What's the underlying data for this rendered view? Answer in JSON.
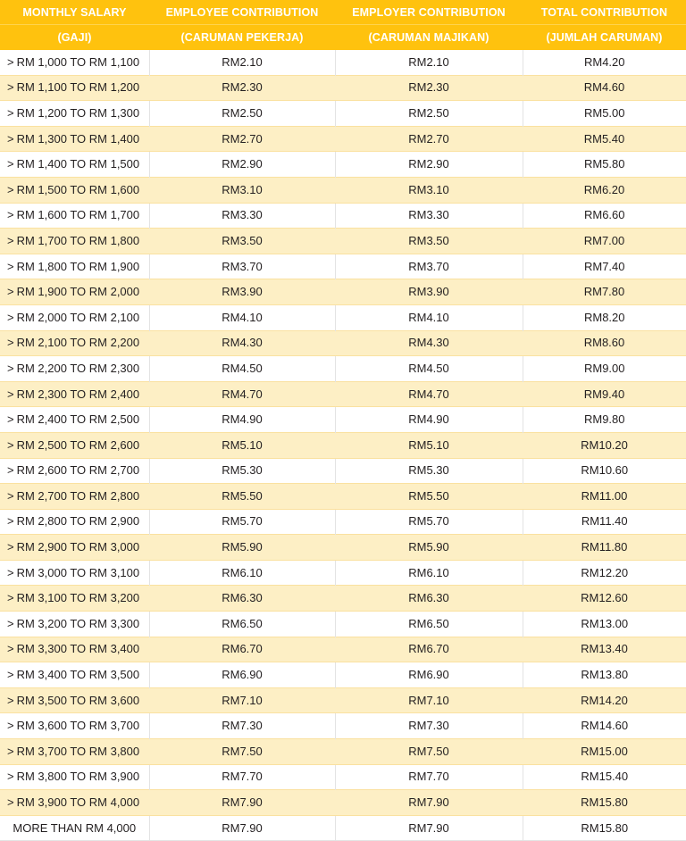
{
  "table": {
    "header": {
      "line1": [
        "MONTHLY SALARY",
        "EMPLOYEE CONTRIBUTION",
        "EMPLOYER CONTRIBUTION",
        "TOTAL CONTRIBUTION"
      ],
      "line2": [
        "(GAJI)",
        "(CARUMAN PEKERJA)",
        "(CARUMAN MAJIKAN)",
        "(JUMLAH CARUMAN)"
      ]
    },
    "colors": {
      "header_background": "#FFC20E",
      "header_text": "#FFFFFF",
      "row_odd_background": "#FFFFFF",
      "row_even_background": "#FDEFC5",
      "row_even_border": "#FAE1A0",
      "column_divider": "#E3E3E3",
      "body_text": "#231F20"
    },
    "rows": [
      {
        "marker": ">",
        "salary": "RM 1,000 TO RM 1,100",
        "employee": "RM2.10",
        "employer": "RM2.10",
        "total": "RM4.20"
      },
      {
        "marker": ">",
        "salary": "RM 1,100 TO RM 1,200",
        "employee": "RM2.30",
        "employer": "RM2.30",
        "total": "RM4.60"
      },
      {
        "marker": ">",
        "salary": "RM 1,200 TO RM 1,300",
        "employee": "RM2.50",
        "employer": "RM2.50",
        "total": "RM5.00"
      },
      {
        "marker": ">",
        "salary": "RM 1,300 TO RM 1,400",
        "employee": "RM2.70",
        "employer": "RM2.70",
        "total": "RM5.40"
      },
      {
        "marker": ">",
        "salary": "RM 1,400 TO RM 1,500",
        "employee": "RM2.90",
        "employer": "RM2.90",
        "total": "RM5.80"
      },
      {
        "marker": ">",
        "salary": "RM 1,500 TO RM 1,600",
        "employee": "RM3.10",
        "employer": "RM3.10",
        "total": "RM6.20"
      },
      {
        "marker": ">",
        "salary": "RM 1,600 TO RM 1,700",
        "employee": "RM3.30",
        "employer": "RM3.30",
        "total": "RM6.60"
      },
      {
        "marker": ">",
        "salary": "RM 1,700 TO RM 1,800",
        "employee": "RM3.50",
        "employer": "RM3.50",
        "total": "RM7.00"
      },
      {
        "marker": ">",
        "salary": "RM 1,800 TO RM 1,900",
        "employee": "RM3.70",
        "employer": "RM3.70",
        "total": "RM7.40"
      },
      {
        "marker": ">",
        "salary": "RM 1,900 TO RM 2,000",
        "employee": "RM3.90",
        "employer": "RM3.90",
        "total": "RM7.80"
      },
      {
        "marker": ">",
        "salary": "RM 2,000 TO RM 2,100",
        "employee": "RM4.10",
        "employer": "RM4.10",
        "total": "RM8.20"
      },
      {
        "marker": ">",
        "salary": "RM 2,100 TO RM 2,200",
        "employee": "RM4.30",
        "employer": "RM4.30",
        "total": "RM8.60"
      },
      {
        "marker": ">",
        "salary": "RM 2,200 TO RM 2,300",
        "employee": "RM4.50",
        "employer": "RM4.50",
        "total": "RM9.00"
      },
      {
        "marker": ">",
        "salary": "RM 2,300 TO RM 2,400",
        "employee": "RM4.70",
        "employer": "RM4.70",
        "total": "RM9.40"
      },
      {
        "marker": ">",
        "salary": "RM 2,400 TO RM 2,500",
        "employee": "RM4.90",
        "employer": "RM4.90",
        "total": "RM9.80"
      },
      {
        "marker": ">",
        "salary": "RM 2,500 TO RM 2,600",
        "employee": "RM5.10",
        "employer": "RM5.10",
        "total": "RM10.20"
      },
      {
        "marker": ">",
        "salary": "RM 2,600 TO RM 2,700",
        "employee": "RM5.30",
        "employer": "RM5.30",
        "total": "RM10.60"
      },
      {
        "marker": ">",
        "salary": "RM 2,700 TO RM 2,800",
        "employee": "RM5.50",
        "employer": "RM5.50",
        "total": "RM11.00"
      },
      {
        "marker": ">",
        "salary": "RM 2,800 TO RM 2,900",
        "employee": "RM5.70",
        "employer": "RM5.70",
        "total": "RM11.40"
      },
      {
        "marker": ">",
        "salary": "RM 2,900 TO RM 3,000",
        "employee": "RM5.90",
        "employer": "RM5.90",
        "total": "RM11.80"
      },
      {
        "marker": ">",
        "salary": "RM 3,000 TO RM 3,100",
        "employee": "RM6.10",
        "employer": "RM6.10",
        "total": "RM12.20"
      },
      {
        "marker": ">",
        "salary": "RM 3,100 TO RM 3,200",
        "employee": "RM6.30",
        "employer": "RM6.30",
        "total": "RM12.60"
      },
      {
        "marker": ">",
        "salary": "RM 3,200 TO RM 3,300",
        "employee": "RM6.50",
        "employer": "RM6.50",
        "total": "RM13.00"
      },
      {
        "marker": ">",
        "salary": "RM 3,300 TO RM 3,400",
        "employee": "RM6.70",
        "employer": "RM6.70",
        "total": "RM13.40"
      },
      {
        "marker": ">",
        "salary": "RM 3,400 TO RM 3,500",
        "employee": "RM6.90",
        "employer": "RM6.90",
        "total": "RM13.80"
      },
      {
        "marker": ">",
        "salary": "RM 3,500 TO RM 3,600",
        "employee": "RM7.10",
        "employer": "RM7.10",
        "total": "RM14.20"
      },
      {
        "marker": ">",
        "salary": "RM 3,600 TO RM 3,700",
        "employee": "RM7.30",
        "employer": "RM7.30",
        "total": "RM14.60"
      },
      {
        "marker": ">",
        "salary": "RM 3,700 TO RM 3,800",
        "employee": "RM7.50",
        "employer": "RM7.50",
        "total": "RM15.00"
      },
      {
        "marker": ">",
        "salary": "RM 3,800 TO RM 3,900",
        "employee": "RM7.70",
        "employer": "RM7.70",
        "total": "RM15.40"
      },
      {
        "marker": ">",
        "salary": "RM 3,900 TO RM 4,000",
        "employee": "RM7.90",
        "employer": "RM7.90",
        "total": "RM15.80"
      },
      {
        "marker": "",
        "salary": "MORE THAN RM 4,000",
        "employee": "RM7.90",
        "employer": "RM7.90",
        "total": "RM15.80"
      }
    ]
  }
}
